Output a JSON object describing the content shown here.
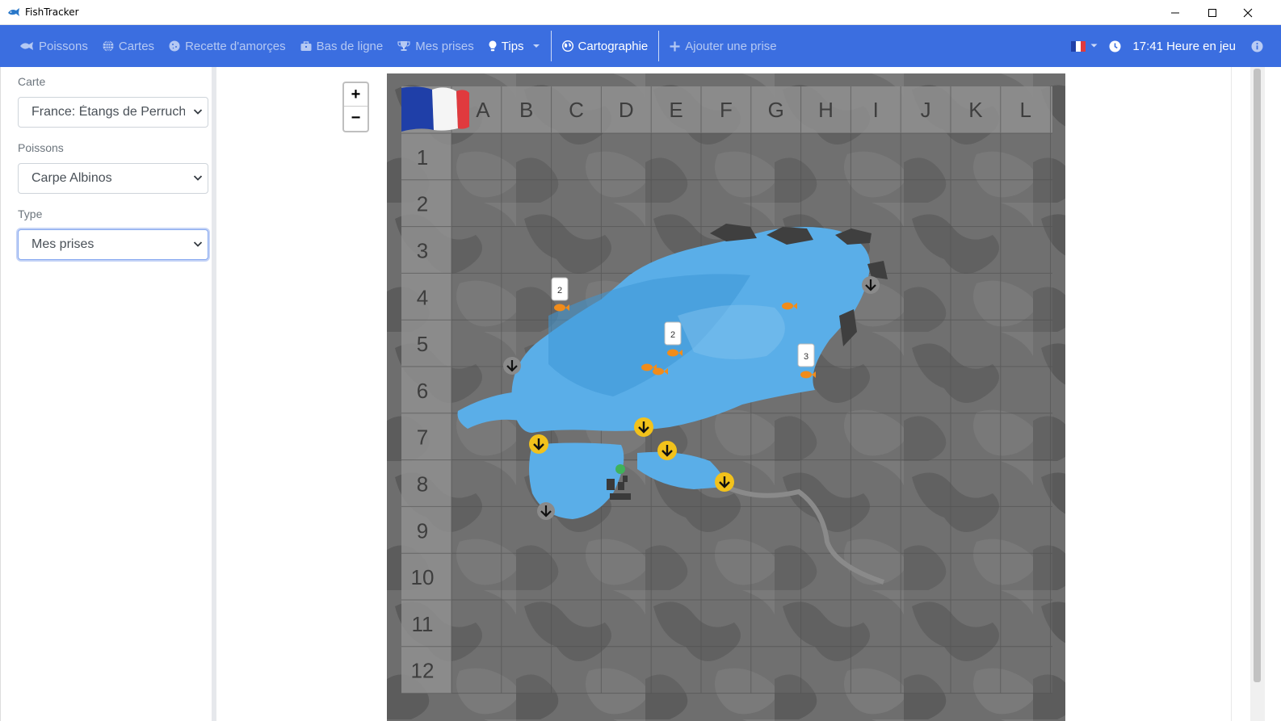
{
  "window": {
    "title": "FishTracker"
  },
  "nav": {
    "items": [
      {
        "label": "Poissons",
        "icon": "fish-icon"
      },
      {
        "label": "Cartes",
        "icon": "globe-icon"
      },
      {
        "label": "Recette d'amorçes",
        "icon": "cookie-icon"
      },
      {
        "label": "Bas de ligne",
        "icon": "toolbox-icon"
      },
      {
        "label": "Mes prises",
        "icon": "trophy-icon"
      },
      {
        "label": "Tips",
        "icon": "lightbulb-icon"
      },
      {
        "label": "Cartographie",
        "icon": "map-globe-icon"
      },
      {
        "label": "Ajouter une prise",
        "icon": "plus-icon"
      }
    ],
    "clock": "17:41 Heure en jeu"
  },
  "sidebar": {
    "map_label": "Carte",
    "map_value": "France: Étangs de Perruche",
    "fish_label": "Poissons",
    "fish_value": "Carpe Albinos",
    "type_label": "Type",
    "type_value": "Mes prises"
  },
  "map": {
    "columns": [
      "A",
      "B",
      "C",
      "D",
      "E",
      "F",
      "G",
      "H",
      "I",
      "J",
      "K",
      "L"
    ],
    "rows": [
      "1",
      "2",
      "3",
      "4",
      "5",
      "6",
      "7",
      "8",
      "9",
      "10",
      "11",
      "12"
    ],
    "markers": [
      {
        "kind": "catch-count",
        "count": "2"
      },
      {
        "kind": "catch-count",
        "count": "2"
      },
      {
        "kind": "catch-count",
        "count": "3"
      }
    ],
    "colors": {
      "water": "#4fa3e0",
      "land": "#5f5f5f",
      "spot_yellow": "#f2c21b",
      "fish_orange": "#f28c1a",
      "accent": "#3b6ee0"
    }
  },
  "zoom": {
    "in_label": "+",
    "out_label": "−"
  }
}
